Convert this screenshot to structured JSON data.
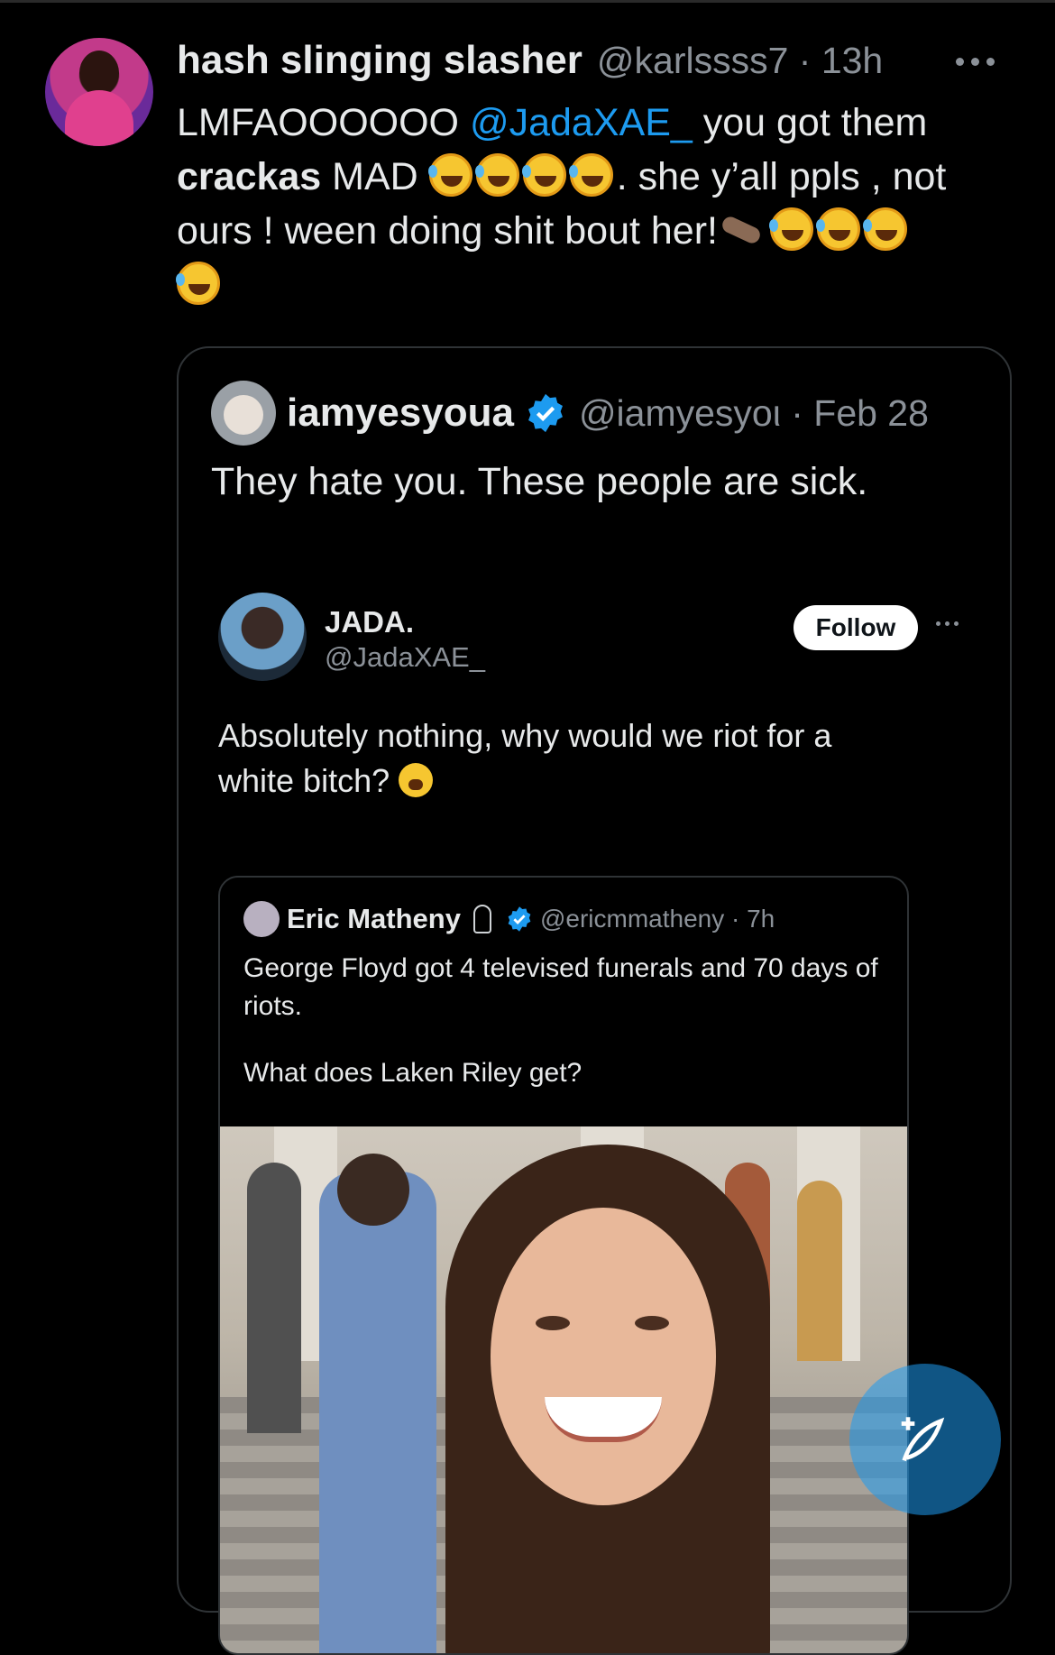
{
  "tweet": {
    "author_name": "hash slinging slasher",
    "handle_time": "@karlssss7 · 13h",
    "text_part1": "LMFAOOOOOO ",
    "mention": "@JadaXAE_",
    "text_part2": " you got them",
    "text_bold": "crackas",
    "text_part3": " MAD ",
    "text_part4": ". she y’all ppls , not ours ! ween doing shit bout her!"
  },
  "quote": {
    "author_name": "iamyesyoua",
    "handle_time": "@iamyesyoι · Feb 28",
    "text": "They hate you. These people are sick."
  },
  "screenshot": {
    "name": "JADA.",
    "handle": "@JadaXAE_",
    "follow_label": "Follow",
    "text": "Absolutely nothing, why would we riot for a white bitch?",
    "inner": {
      "name": "Eric Matheny",
      "handle_time": "@ericmmatheny · 7h",
      "text1": "George Floyd got 4 televised funerals and 70 days of riots.",
      "text2": "What does Laken Riley get?"
    }
  },
  "icons": {
    "more": "more-icon",
    "verified": "verified-badge-icon",
    "compose": "compose-post-icon",
    "emoji": "rolling-on-floor-laughing-emoji",
    "crying": "loudly-crying-emoji",
    "otter": "otter-emoji",
    "mic": "studio-microphone-emoji"
  },
  "colors": {
    "accent": "#1d9bf0",
    "background": "#000000",
    "secondary_text": "#8b9198"
  }
}
